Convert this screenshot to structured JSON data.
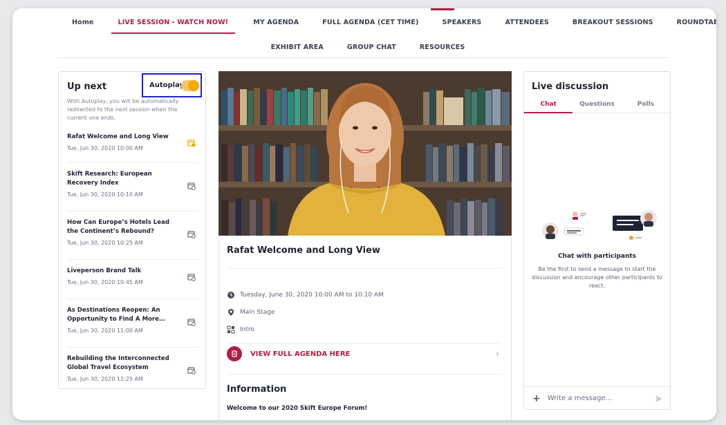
{
  "nav": {
    "row1": [
      "Home",
      "LIVE SESSION - WATCH NOW!",
      "MY AGENDA",
      "FULL AGENDA (CET TIME)",
      "SPEAKERS",
      "ATTENDEES",
      "BREAKOUT SESSIONS",
      "ROUNDTABLES"
    ],
    "row2": [
      "EXHIBIT AREA",
      "GROUP CHAT",
      "RESOURCES"
    ],
    "active": "LIVE SESSION - WATCH NOW!"
  },
  "up_next": {
    "title": "Up next",
    "autoplay_label": "Autoplay",
    "autoplay_on": true,
    "description": "With Autoplay, you will be automatically redirected to the next session when the current one ends.",
    "sessions": [
      {
        "title": "Rafat Welcome and Long View",
        "time": "Tue, Jun 30, 2020 10:00 AM",
        "icon": "calendar-icon",
        "current": true
      },
      {
        "title": "Skift Research: European Recovery Index",
        "time": "Tue, Jun 30, 2020 10:10 AM",
        "icon": "calendar-icon"
      },
      {
        "title": "How Can Europe’s Hotels Lead the Continent’s Rebound?",
        "time": "Tue, Jun 30, 2020 10:25 AM",
        "icon": "calendar-icon"
      },
      {
        "title": "Liveperson Brand Talk",
        "time": "Tue, Jun 30, 2020 10:45 AM",
        "icon": "calendar-icon"
      },
      {
        "title": "As Destinations Reopen: An Opportunity to Find A More…",
        "time": "Tue, Jun 30, 2020 11:00 AM",
        "icon": "calendar-icon"
      },
      {
        "title": "Rebuilding the Interconnected Global Travel Ecosystem",
        "time": "Tue, Jun 30, 2020 11:25 AM",
        "icon": "calendar-icon"
      }
    ]
  },
  "session": {
    "title": "Rafat Welcome and Long View",
    "datetime": "Tuesday, June 30, 2020 10:00 AM to 10:10 AM",
    "location": "Main Stage",
    "category": "Intro",
    "agenda_link": "VIEW FULL AGENDA HERE",
    "info_heading": "Information",
    "info_text": "Welcome to our 2020 Skift Europe Forum!"
  },
  "discussion": {
    "title": "Live discussion",
    "tabs": [
      "Chat",
      "Questions",
      "Polls"
    ],
    "active_tab": "Chat",
    "empty_title": "Chat with participants",
    "empty_desc": "Be the first to send a message to start the discussion and encourage other participants to react.",
    "compose_placeholder": "Write a message..."
  },
  "colors": {
    "accent": "#b11d45",
    "toggle": "#f2a900",
    "highlight_box": "#1d22c9"
  }
}
